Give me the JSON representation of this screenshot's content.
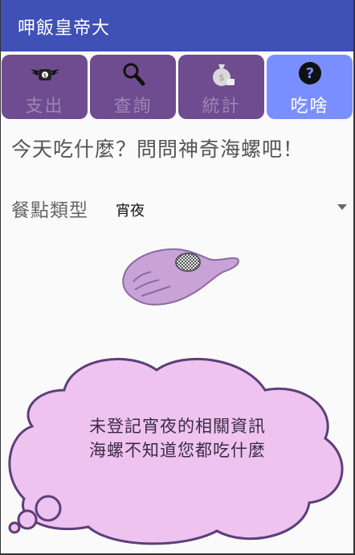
{
  "app": {
    "title": "呷飯皇帝大"
  },
  "tabs": [
    {
      "label": "支出",
      "icon": "winged-wallet-icon",
      "active": false
    },
    {
      "label": "查詢",
      "icon": "magnifier-icon",
      "active": false
    },
    {
      "label": "統計",
      "icon": "money-bag-icon",
      "active": false
    },
    {
      "label": "吃啥",
      "icon": "question-circle-icon",
      "active": true
    }
  ],
  "main": {
    "headline": "今天吃什麼？問問神奇海螺吧！",
    "category_label": "餐點類型",
    "category_value": "宵夜",
    "bubble_line1": "未登記宵夜的相關資訊",
    "bubble_line2": "海螺不知道您都吃什麼"
  },
  "colors": {
    "appbar": "#3f51b5",
    "tab_inactive": "#6f4b8f",
    "tab_active": "#7a8fff",
    "cloud_fill": "#efc3ef",
    "cloud_stroke": "#5b3f7a"
  }
}
